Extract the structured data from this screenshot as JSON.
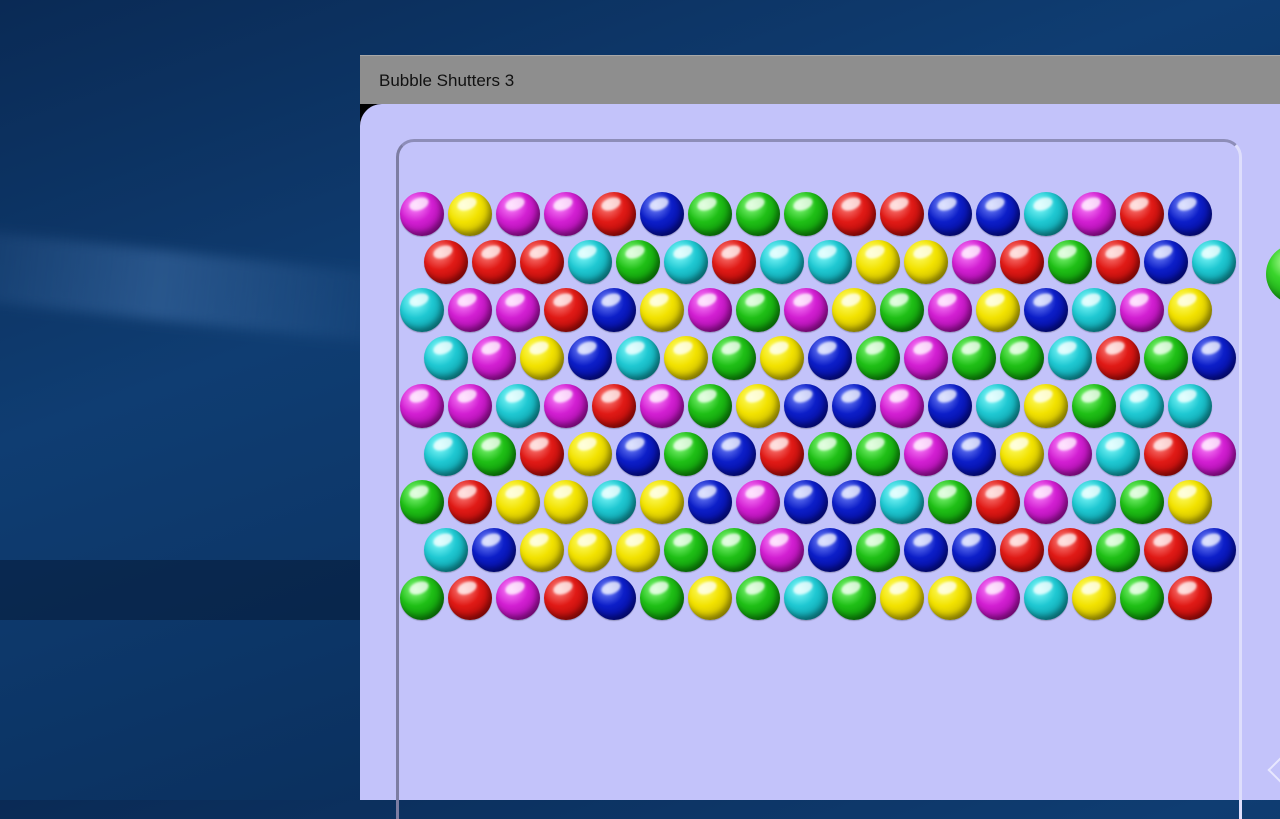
{
  "window": {
    "title": "Bubble Shutters 3"
  },
  "colors": {
    "magenta": "#d21fd2",
    "yellow": "#f2e200",
    "red": "#e01a16",
    "blue": "#0c1ec8",
    "green": "#1fbf16",
    "cyan": "#1fc8d2",
    "board": "#c3c3fa",
    "titlebar": "#8e8e8e"
  },
  "grid": [
    "MYMMRBGGGRRBBCMRB",
    "RRRCGCRCCYYMRGRBC",
    "CMMRBYMGMYGMYBCMY",
    "CMYBCYGYBGMGGCRGB",
    "MMCMRMGYBBMBCYGCC",
    "CGRYBGBRGGMBYMCRM",
    "GRYYCYBMBBCGRMCGY",
    "CBYYYGGMBGBBRRGRB",
    "GRMRBGYGCGYYMCYGR"
  ],
  "next_bubble": {
    "color": "green"
  }
}
